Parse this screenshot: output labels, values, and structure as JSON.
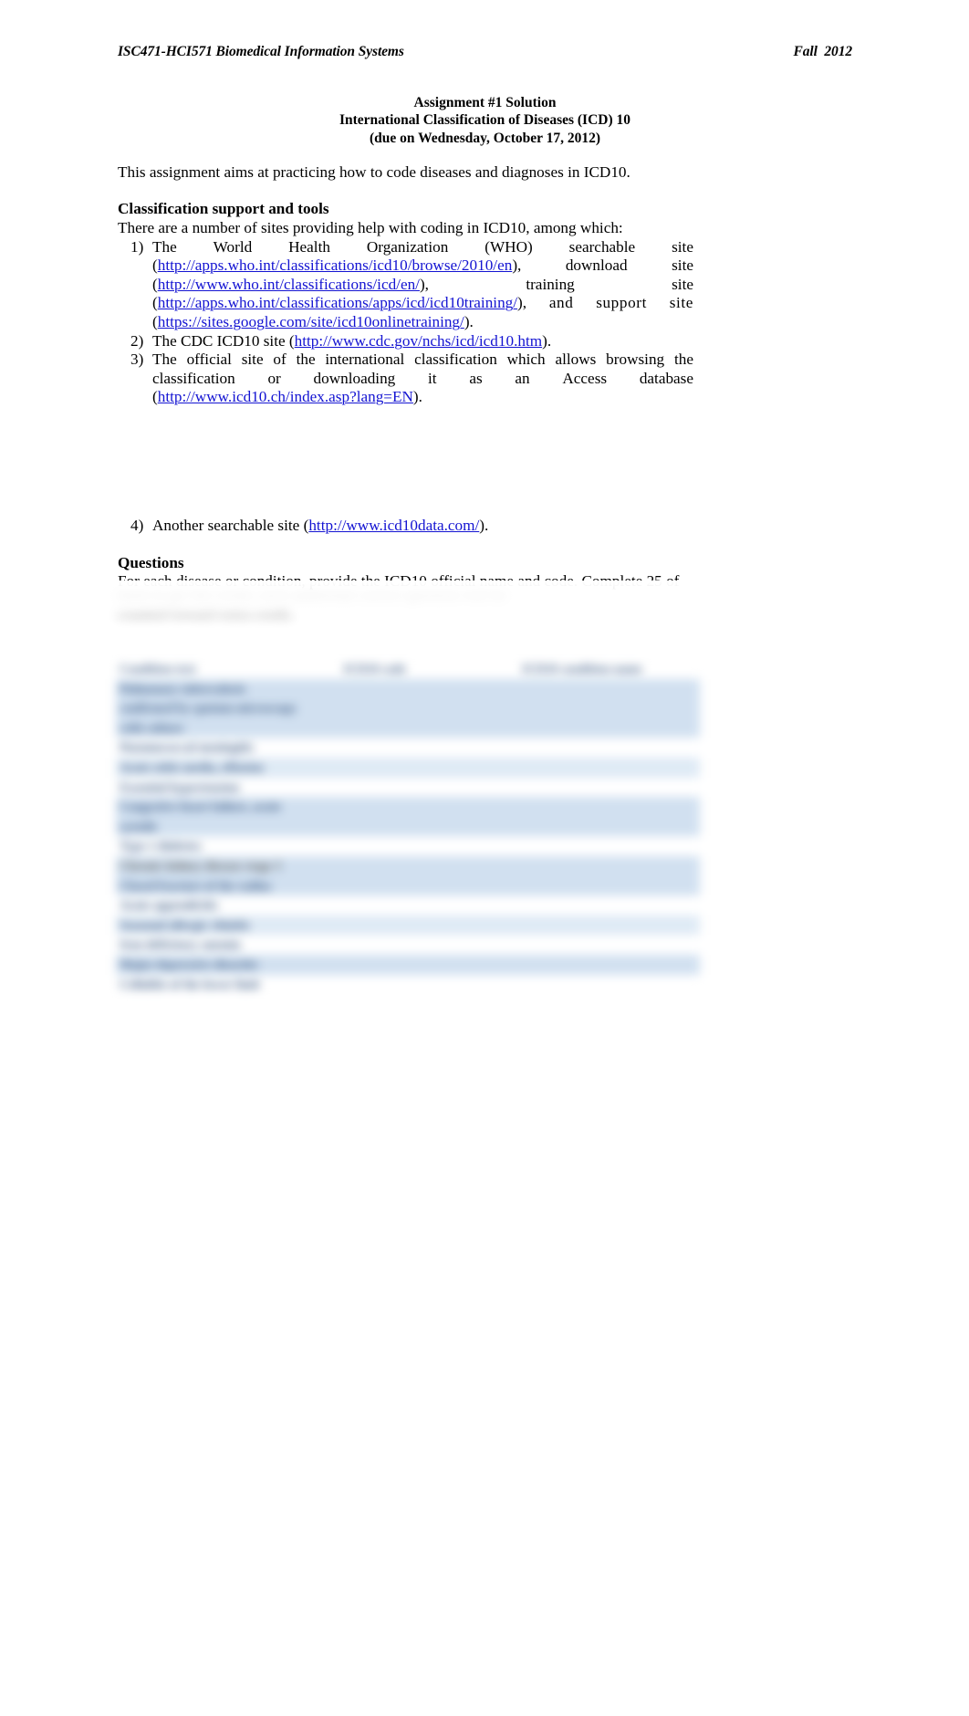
{
  "header": {
    "course": "ISC471-HCI571 Biomedical Information Systems",
    "term": "Fall  2012"
  },
  "title": {
    "line1": "Assignment #1 Solution",
    "line2": "International Classification of Diseases (ICD) 10",
    "line3": "(due on Wednesday, October 17, 2012)"
  },
  "intro": "This assignment aims at practicing how to code diseases and diagnoses in ICD10.",
  "sections": {
    "tools_heading": "Classification support and tools",
    "tools_lead": "There are a number of sites providing help with coding in ICD10, among which:",
    "questions_heading": "Questions",
    "questions_lead": "For each disease or condition, provide the ICD10 official name and code. Complete 25 of"
  },
  "list": {
    "item1": {
      "marker": "1)",
      "w_the": "The",
      "w_world": "World",
      "w_health": "Health",
      "w_organization": "Organization",
      "w_who": "(WHO)",
      "w_searchable": "searchable",
      "w_site1": "site",
      "open1": "(",
      "url1": "http://apps.who.int/classifications/icd10/browse/2010/en",
      "close1": "),",
      "w_download": "download",
      "w_site2": "site",
      "open2": "(",
      "url2": "http://www.who.int/classifications/icd/en/",
      "close2": "),",
      "w_training": "training",
      "w_site3": "site",
      "open3": "(",
      "url3": "http://apps.who.int/classifications/apps/icd/icd10training/",
      "close3": "),",
      "w_and": "and",
      "w_support": "support",
      "w_site4": "site",
      "open4": "(",
      "url4": "https://sites.google.com/site/icd10onlinetraining/",
      "close4": ")."
    },
    "item2": {
      "marker": "2)",
      "pre": "The CDC ICD10 site (",
      "url": "http://www.cdc.gov/nchs/icd/icd10.htm",
      "post": ")."
    },
    "item3": {
      "marker": "3)",
      "l1_a": "The",
      "l1_b": "official",
      "l1_c": "site",
      "l1_d": "of",
      "l1_e": "the",
      "l1_f": "international",
      "l1_g": "classification",
      "l1_h": "which",
      "l1_i": "allows",
      "l1_j": "browsing",
      "l1_k": "the",
      "l2_a": "classification",
      "l2_b": "or",
      "l2_c": "downloading",
      "l2_d": "it",
      "l2_e": "as",
      "l2_f": "an",
      "l2_g": "Access",
      "l2_h": "database",
      "open": "(",
      "url": "http://www.icd10.ch/index.asp?lang=EN",
      "close": ")."
    },
    "item4": {
      "marker": "4)",
      "pre": "Another searchable site (",
      "url": "http://www.icd10data.com/",
      "post": ")."
    }
  },
  "obscured": {
    "note": "content below is blurred in the source screenshot",
    "line_a": "them to get the credit; each additional correct question will be",
    "line_b": "counted toward extra credit.",
    "table": {
      "headers": [
        "Condition text",
        "ICD10 code",
        "ICD10 condition name"
      ],
      "rows": [
        [
          "Pulmonary  tuberculosis",
          "",
          ""
        ],
        [
          "confirmed by sputum microscopy",
          "",
          ""
        ],
        [
          "with culture",
          "",
          ""
        ],
        [
          "Pneumococcal meningitis",
          "",
          ""
        ],
        [
          "Acute otitis media, effusion",
          "",
          ""
        ],
        [
          "Essential hypertension",
          "",
          ""
        ],
        [
          "Congestive heart failure, acute",
          "",
          ""
        ],
        [
          "systolic",
          "",
          ""
        ],
        [
          "Type 1 diabetes",
          "",
          ""
        ],
        [
          "Chronic kidney disease stage 3",
          "",
          ""
        ],
        [
          "Closed fracture of the radius",
          "",
          ""
        ],
        [
          "Acute appendicitis",
          "",
          ""
        ],
        [
          "Seasonal allergic rhinitis",
          "",
          ""
        ],
        [
          "Iron deficiency anemia",
          "",
          ""
        ],
        [
          "Major depressive disorder",
          "",
          ""
        ],
        [
          "Cellulitis of the lower limb",
          "",
          ""
        ]
      ]
    }
  },
  "colors": {
    "link": "#1414d2",
    "table_band": "#cfdff0",
    "table_band_light": "#dde9f5",
    "page": "#ffffff"
  }
}
